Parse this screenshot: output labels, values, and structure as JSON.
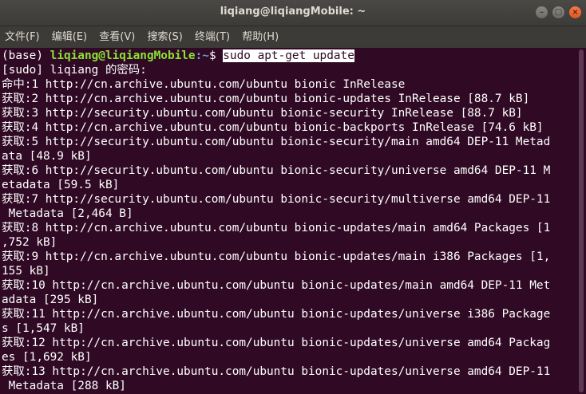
{
  "window": {
    "title": "liqiang@liqiangMobile: ~"
  },
  "controls": {
    "minimize": "–",
    "maximize": "□",
    "close": "×"
  },
  "menu": [
    "文件(F)",
    "编辑(E)",
    "查看(V)",
    "搜索(S)",
    "终端(T)",
    "帮助(H)"
  ],
  "prompt": {
    "env": "(base) ",
    "user_host": "liqiang@liqiangMobile",
    "path": ":~",
    "symbol": "$ ",
    "command": "sudo apt-get update"
  },
  "output": [
    "[sudo] liqiang 的密码:",
    "命中:1 http://cn.archive.ubuntu.com/ubuntu bionic InRelease",
    "获取:2 http://cn.archive.ubuntu.com/ubuntu bionic-updates InRelease [88.7 kB]",
    "获取:3 http://security.ubuntu.com/ubuntu bionic-security InRelease [88.7 kB]",
    "获取:4 http://cn.archive.ubuntu.com/ubuntu bionic-backports InRelease [74.6 kB]",
    "获取:5 http://security.ubuntu.com/ubuntu bionic-security/main amd64 DEP-11 Metad",
    "ata [48.9 kB]",
    "获取:6 http://security.ubuntu.com/ubuntu bionic-security/universe amd64 DEP-11 M",
    "etadata [59.5 kB]",
    "获取:7 http://security.ubuntu.com/ubuntu bionic-security/multiverse amd64 DEP-11",
    " Metadata [2,464 B]",
    "获取:8 http://cn.archive.ubuntu.com/ubuntu bionic-updates/main amd64 Packages [1",
    ",752 kB]",
    "获取:9 http://cn.archive.ubuntu.com/ubuntu bionic-updates/main i386 Packages [1,",
    "155 kB]",
    "获取:10 http://cn.archive.ubuntu.com/ubuntu bionic-updates/main amd64 DEP-11 Met",
    "adata [295 kB]",
    "获取:11 http://cn.archive.ubuntu.com/ubuntu bionic-updates/universe i386 Package",
    "s [1,547 kB]",
    "获取:12 http://cn.archive.ubuntu.com/ubuntu bionic-updates/universe amd64 Packag",
    "es [1,692 kB]",
    "获取:13 http://cn.archive.ubuntu.com/ubuntu bionic-updates/universe amd64 DEP-11",
    " Metadata [288 kB]"
  ],
  "colors": {
    "terminal_bg": "#300a24",
    "prompt_user": "#8ae234",
    "prompt_path": "#729fcf",
    "titlebar_bg": "#3c3b37"
  }
}
